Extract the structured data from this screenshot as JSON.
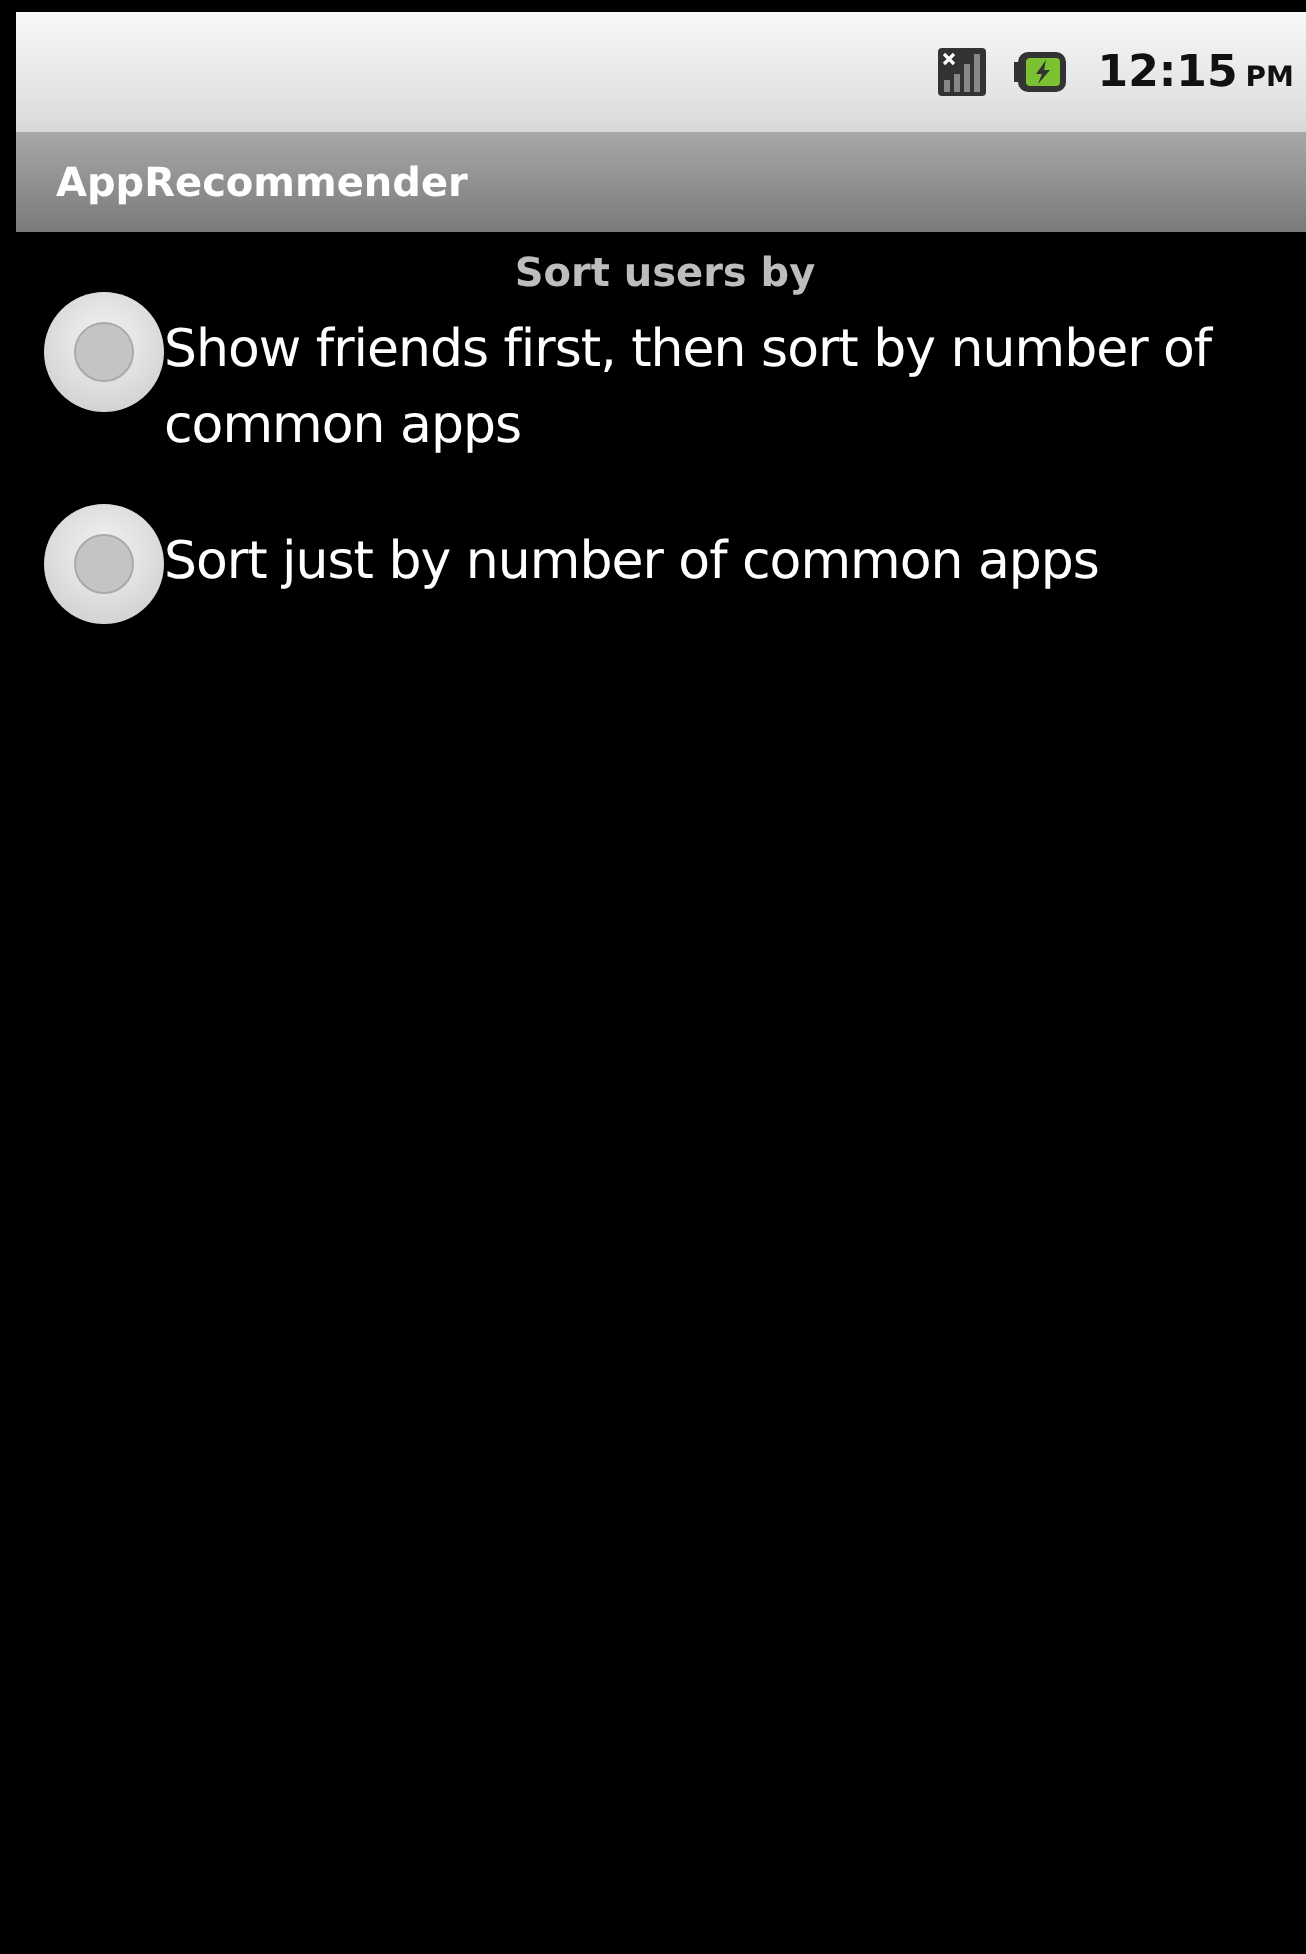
{
  "status_bar": {
    "time": "12:15",
    "time_suffix": "PM"
  },
  "window": {
    "title": "AppRecommender"
  },
  "prompt": "Sort users by",
  "options": [
    {
      "label": "Show friends first, then sort by number of common apps",
      "selected": false
    },
    {
      "label": "Sort just by number of common apps",
      "selected": false
    }
  ]
}
